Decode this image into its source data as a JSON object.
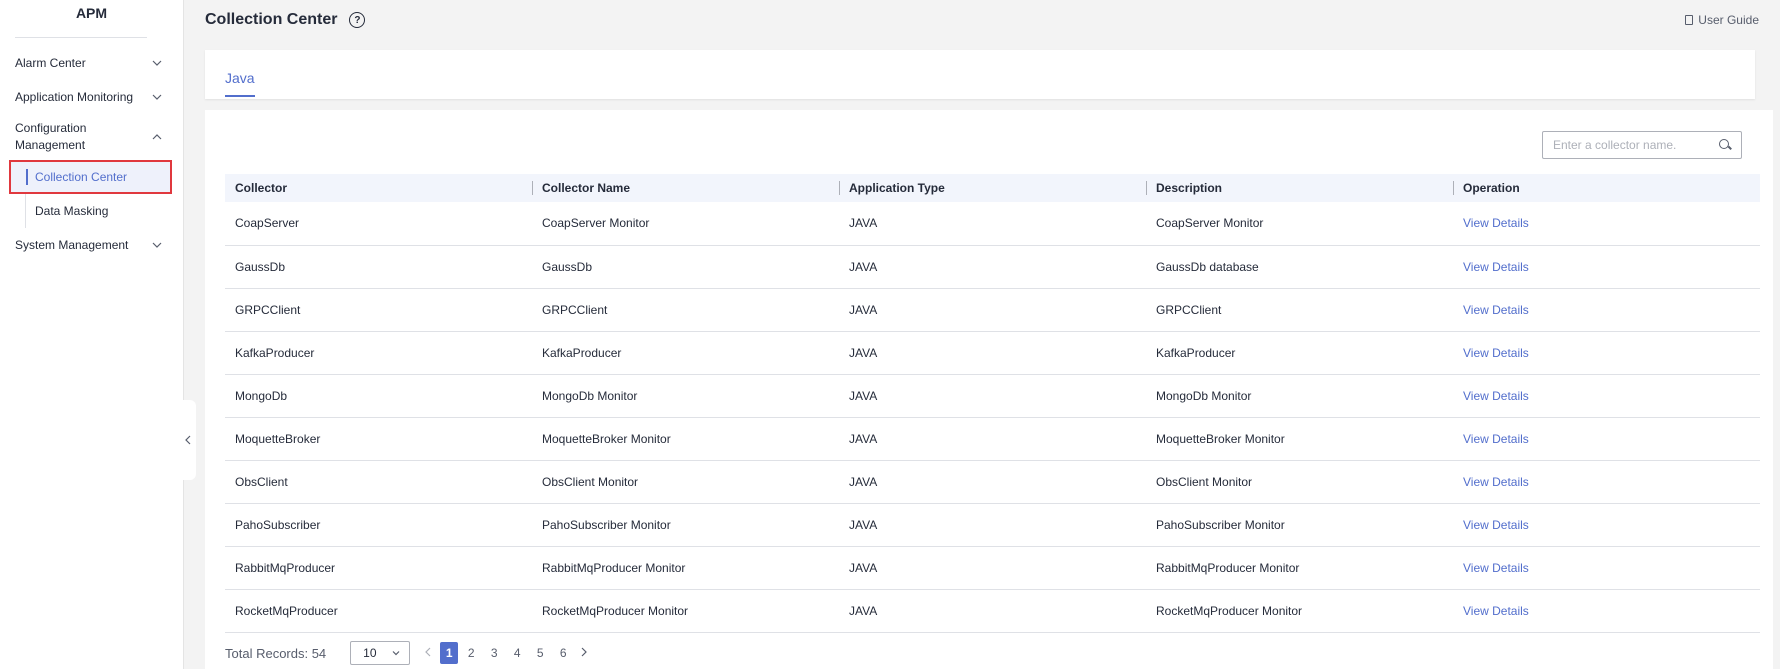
{
  "sidebar": {
    "title": "APM",
    "items": [
      {
        "label": "Alarm Center"
      },
      {
        "label": "Application Monitoring"
      },
      {
        "label_line1": "Configuration",
        "label_line2": "Management"
      },
      {
        "label": "System Management"
      }
    ],
    "sub_items": [
      {
        "label": "Collection Center"
      },
      {
        "label": "Data Masking"
      }
    ]
  },
  "header": {
    "title": "Collection Center",
    "help_glyph": "?",
    "user_guide": "User Guide"
  },
  "tabs": [
    {
      "label": "Java"
    }
  ],
  "search": {
    "placeholder": "Enter a collector name."
  },
  "table": {
    "columns": [
      "Collector",
      "Collector Name",
      "Application Type",
      "Description",
      "Operation"
    ],
    "rows": [
      {
        "collector": "CoapServer",
        "name": "CoapServer Monitor",
        "type": "JAVA",
        "description": "CoapServer Monitor",
        "operation": "View Details"
      },
      {
        "collector": "GaussDb",
        "name": "GaussDb",
        "type": "JAVA",
        "description": "GaussDb database",
        "operation": "View Details"
      },
      {
        "collector": "GRPCClient",
        "name": "GRPCClient",
        "type": "JAVA",
        "description": "GRPCClient",
        "operation": "View Details"
      },
      {
        "collector": "KafkaProducer",
        "name": "KafkaProducer",
        "type": "JAVA",
        "description": "KafkaProducer",
        "operation": "View Details"
      },
      {
        "collector": "MongoDb",
        "name": "MongoDb Monitor",
        "type": "JAVA",
        "description": "MongoDb Monitor",
        "operation": "View Details"
      },
      {
        "collector": "MoquetteBroker",
        "name": "MoquetteBroker Monitor",
        "type": "JAVA",
        "description": "MoquetteBroker Monitor",
        "operation": "View Details"
      },
      {
        "collector": "ObsClient",
        "name": "ObsClient Monitor",
        "type": "JAVA",
        "description": "ObsClient Monitor",
        "operation": "View Details"
      },
      {
        "collector": "PahoSubscriber",
        "name": "PahoSubscriber Monitor",
        "type": "JAVA",
        "description": "PahoSubscriber Monitor",
        "operation": "View Details"
      },
      {
        "collector": "RabbitMqProducer",
        "name": "RabbitMqProducer Monitor",
        "type": "JAVA",
        "description": "RabbitMqProducer Monitor",
        "operation": "View Details"
      },
      {
        "collector": "RocketMqProducer",
        "name": "RocketMqProducer Monitor",
        "type": "JAVA",
        "description": "RocketMqProducer Monitor",
        "operation": "View Details"
      }
    ]
  },
  "pagination": {
    "total": "Total Records: 54",
    "page_size": "10",
    "pages": [
      "1",
      "2",
      "3",
      "4",
      "5",
      "6"
    ],
    "current": "1"
  },
  "colors": {
    "accent": "#526ecc",
    "highlight_border": "#e0383e"
  },
  "icons": [
    "chevron-down-icon",
    "chevron-up-icon",
    "help-icon",
    "document-icon",
    "search-icon",
    "chevron-left-icon",
    "chevron-right-icon"
  ]
}
